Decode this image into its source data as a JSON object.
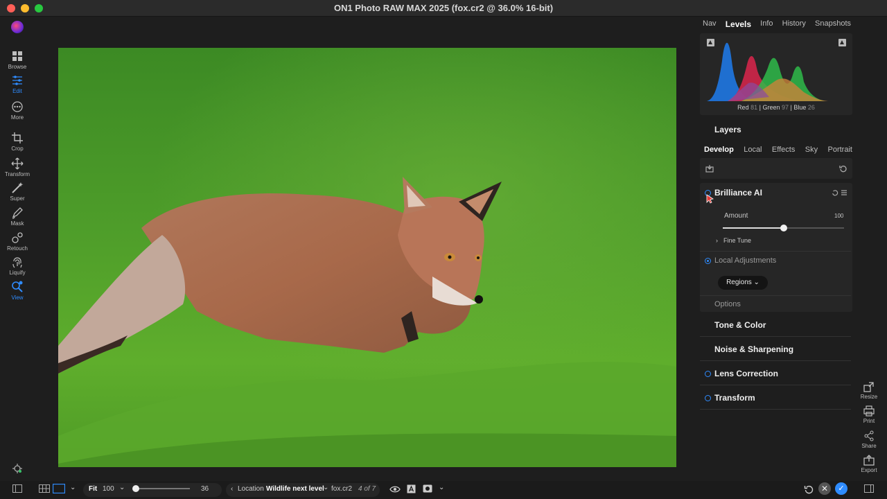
{
  "window": {
    "title": "ON1 Photo RAW MAX 2025 (fox.cr2 @ 36.0% 16-bit)"
  },
  "left_tools": [
    {
      "label": "Browse",
      "icon": "grid-icon"
    },
    {
      "label": "Edit",
      "icon": "sliders-icon"
    },
    {
      "label": "More",
      "icon": "more-icon"
    },
    {
      "label": "Crop",
      "icon": "crop-icon"
    },
    {
      "label": "Transform",
      "icon": "move-icon"
    },
    {
      "label": "Super",
      "icon": "wand-icon"
    },
    {
      "label": "Mask",
      "icon": "brush-icon"
    },
    {
      "label": "Retouch",
      "icon": "retouch-icon"
    },
    {
      "label": "Liquify",
      "icon": "fingerprint-icon"
    },
    {
      "label": "View",
      "icon": "zoom-icon"
    }
  ],
  "panel_tabs": [
    "Nav",
    "Levels",
    "Info",
    "History",
    "Snapshots"
  ],
  "active_panel_tab": "Levels",
  "histogram": {
    "red_label": "Red",
    "red": "81",
    "green_label": "| Green",
    "green": "97",
    "blue_label": "| Blue",
    "blue": "26"
  },
  "layers_title": "Layers",
  "develop_tabs": [
    "Develop",
    "Local",
    "Effects",
    "Sky",
    "Portrait"
  ],
  "brilliance": {
    "title": "Brilliance AI",
    "amount_label": "Amount",
    "amount_value": "100",
    "amount_fraction": 0.5,
    "fine_tune": "Fine Tune",
    "local_adjustments": "Local Adjustments",
    "regions_button": "Regions",
    "options": "Options"
  },
  "sections": [
    {
      "title": "Tone & Color",
      "radio": false
    },
    {
      "title": "Noise & Sharpening",
      "radio": false
    },
    {
      "title": "Lens Correction",
      "radio": true
    },
    {
      "title": "Transform",
      "radio": true
    }
  ],
  "right_tools": [
    {
      "label": "Resize",
      "icon": "resize-icon"
    },
    {
      "label": "Print",
      "icon": "print-icon"
    },
    {
      "label": "Share",
      "icon": "share-icon"
    },
    {
      "label": "Export",
      "icon": "export-icon"
    }
  ],
  "bottom": {
    "fit": "Fit",
    "zoom": "100",
    "slider_value": "36",
    "slider_fraction": 0.0,
    "location_label": "Location",
    "location_name": "Wildlife next level",
    "filename": "fox.cr2",
    "counter": "4 of 7"
  },
  "colors": {
    "accent": "#2f8cff"
  }
}
